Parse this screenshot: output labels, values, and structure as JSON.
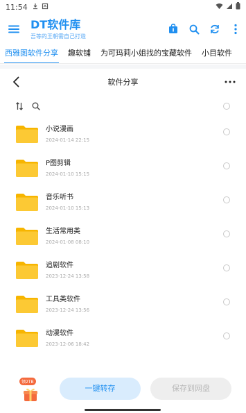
{
  "status_bar": {
    "time": "11:54",
    "left_icons": [
      "download-icon",
      "notification-box-icon"
    ],
    "right_icons": [
      "wifi-icon",
      "signal-icon",
      "battery-icon"
    ]
  },
  "app_bar": {
    "title": "DT软件库",
    "subtitle": "吾等的王朝需自己打造",
    "actions": [
      "shop-bag-icon",
      "search-icon",
      "refresh-icon",
      "more-vertical-icon"
    ]
  },
  "tabs": [
    {
      "label": "西雅图软件分享",
      "active": true
    },
    {
      "label": "趣软铺",
      "active": false
    },
    {
      "label": "为可玛莉小姐找的宝藏软件",
      "active": false
    },
    {
      "label": "小目软件",
      "active": false
    }
  ],
  "folder_header": {
    "title": "软件分享"
  },
  "files": [
    {
      "name": "小说漫画",
      "date": "2024-01-14 22:15"
    },
    {
      "name": "P图剪辑",
      "date": "2024-01-10 15:15"
    },
    {
      "name": "音乐听书",
      "date": "2024-01-10 15:13"
    },
    {
      "name": "生活常用类",
      "date": "2024-01-08 08:10"
    },
    {
      "name": "追剧软件",
      "date": "2023-12-24 13:58"
    },
    {
      "name": "工具类软件",
      "date": "2023-12-24 13:56"
    },
    {
      "name": "动漫软件",
      "date": "2023-12-06 18:42"
    }
  ],
  "bottom_bar": {
    "gift_badge": "领2TB",
    "save_button": "一键转存",
    "save_to_disk_button": "保存到网盘"
  },
  "colors": {
    "accent": "#1f8ff0",
    "folder": "#f9c623",
    "save_button_bg": "#d9ecfd",
    "disabled_button_bg": "#eeeeee"
  }
}
